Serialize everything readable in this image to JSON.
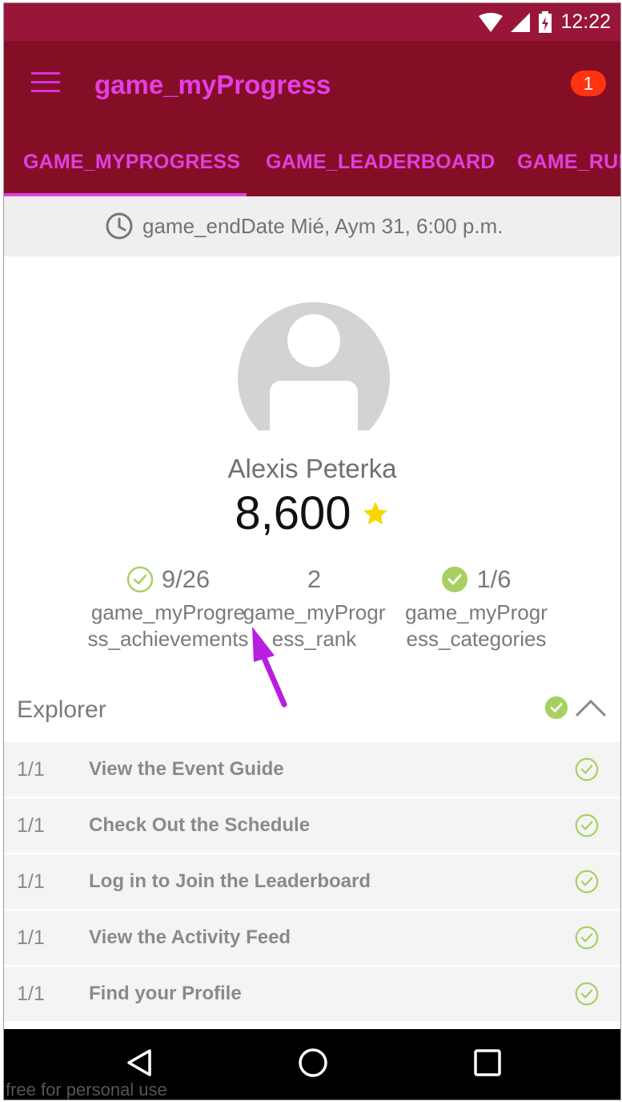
{
  "status_bar": {
    "time": "12:22"
  },
  "app_bar": {
    "title": "game_myProgress",
    "notification_count": "1"
  },
  "tabs": [
    {
      "label": "GAME_MYPROGRESS",
      "selected": true
    },
    {
      "label": "GAME_LEADERBOARD",
      "selected": false
    },
    {
      "label": "GAME_RULES",
      "selected": false
    }
  ],
  "end_date": {
    "text": "game_endDate Mié, Aym 31, 6:00 p.m."
  },
  "profile": {
    "name": "Alexis Peterka",
    "points": "8,600"
  },
  "stats": [
    {
      "value": "9/26",
      "label": "game_myProgress_achievements",
      "icon": "check-outline-icon"
    },
    {
      "value": "2",
      "label": "game_myProgress_rank",
      "icon": ""
    },
    {
      "value": "1/6",
      "label": "game_myProgress_categories",
      "icon": "check-filled-icon"
    }
  ],
  "category": {
    "title": "Explorer",
    "items": [
      {
        "count": "1/1",
        "title": "View the Event Guide"
      },
      {
        "count": "1/1",
        "title": "Check Out the Schedule"
      },
      {
        "count": "1/1",
        "title": "Log in to Join the Leaderboard"
      },
      {
        "count": "1/1",
        "title": "View the Activity Feed"
      },
      {
        "count": "1/1",
        "title": "Find your Profile"
      }
    ]
  },
  "watermark": "free for personal use",
  "colors": {
    "status_bar": "#9a1638",
    "app_bar": "#850e27",
    "accent": "#e040e0",
    "check_green": "#a8d060",
    "badge": "#ff3311",
    "star": "#f5d800",
    "annotation_arrow": "#b81de0"
  }
}
